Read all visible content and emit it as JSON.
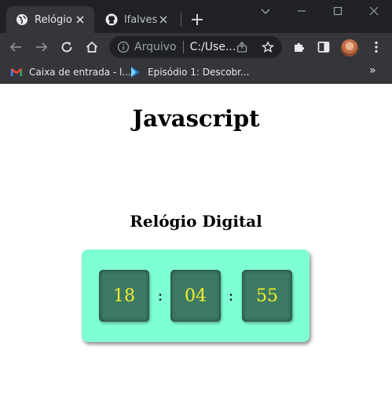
{
  "browser": {
    "tabs": [
      {
        "title": "Relógio",
        "active": true,
        "icon": "globe-icon"
      },
      {
        "title": "lfalvespe",
        "active": false,
        "icon": "github-icon"
      }
    ],
    "address": {
      "scheme_label": "Arquivo",
      "url": "C:/Use..."
    },
    "bookmarks": [
      {
        "label": "Caixa de entrada - l...",
        "icon": "gmail-icon"
      },
      {
        "label": "Episódio 1: Descobr...",
        "icon": "play-icon"
      }
    ],
    "bookmarks_more": "»",
    "colors": {
      "frame": "#202124",
      "toolbar": "#35363a",
      "text": "#e8eaed"
    }
  },
  "page": {
    "heading": "Javascript",
    "clock": {
      "title": "Relógio Digital",
      "hours": "18",
      "minutes": "04",
      "seconds": "55",
      "separator": ":",
      "colors": {
        "panel": "#7fffd4",
        "box": "#3c7a64",
        "digits": "#f5ee28"
      }
    }
  }
}
